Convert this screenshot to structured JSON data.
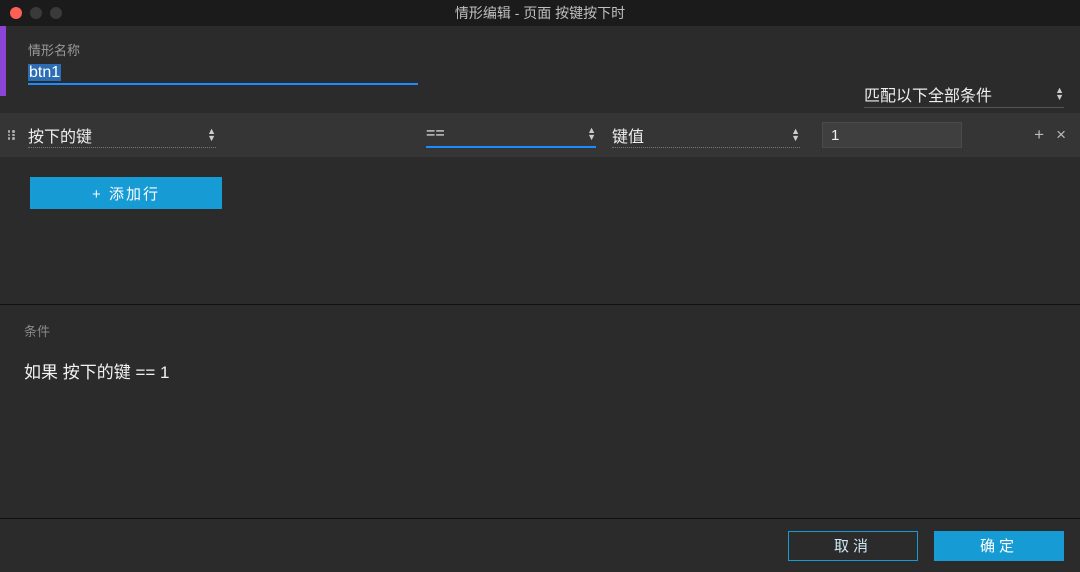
{
  "titlebar": {
    "title": "情形编辑   -   页面 按键按下时"
  },
  "form": {
    "name_label": "情形名称",
    "name_value": "btn1",
    "match_label": "匹配以下全部条件"
  },
  "row": {
    "subject": "按下的键",
    "operator": "==",
    "target": "键值",
    "value": "1"
  },
  "buttons": {
    "add_row": "+ 添加行",
    "cancel": "取消",
    "ok": "确定"
  },
  "summary": {
    "label": "条件",
    "text": "如果 按下的键 == 1"
  },
  "icons": {
    "plus": "+",
    "close": "×"
  }
}
